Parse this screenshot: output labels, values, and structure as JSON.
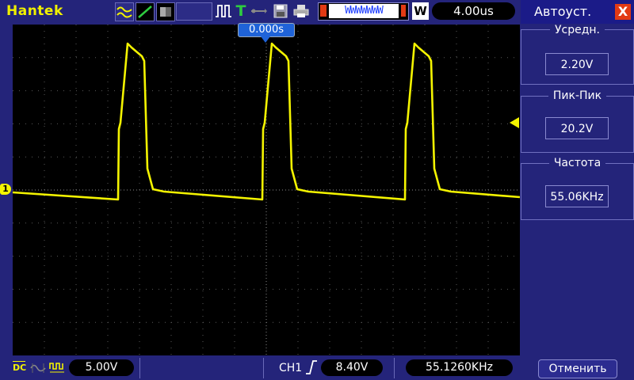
{
  "app": {
    "brand": "Hantek"
  },
  "toolbar": {
    "icons": [
      "waveform-mode-icon",
      "line-mode-icon",
      "persist-mode-icon",
      "blank-slot",
      "trigger-pulse-icon",
      "trigger-T-icon",
      "usb-icon",
      "save-icon",
      "print-icon"
    ],
    "memory_indicator": "WWWWWWW",
    "window_mode": "W",
    "timebase": "4.00us"
  },
  "screen": {
    "trigger_time": "0.000s",
    "channel_marker": "1",
    "trace_color": "#f4f400"
  },
  "bottom": {
    "coupling": "DC",
    "ch1_scale": "5.00V",
    "trigger_source": "CH1",
    "trigger_level": "8.40V",
    "frequency": "55.1260KHz"
  },
  "panel": {
    "title": "Автоуст.",
    "close": "X",
    "groups": [
      {
        "label": "Усредн.",
        "value": "2.20V"
      },
      {
        "label": "Пик-Пик",
        "value": "20.2V"
      },
      {
        "label": "Частота",
        "value": "55.06KHz"
      }
    ],
    "cancel": "Отменить"
  }
}
